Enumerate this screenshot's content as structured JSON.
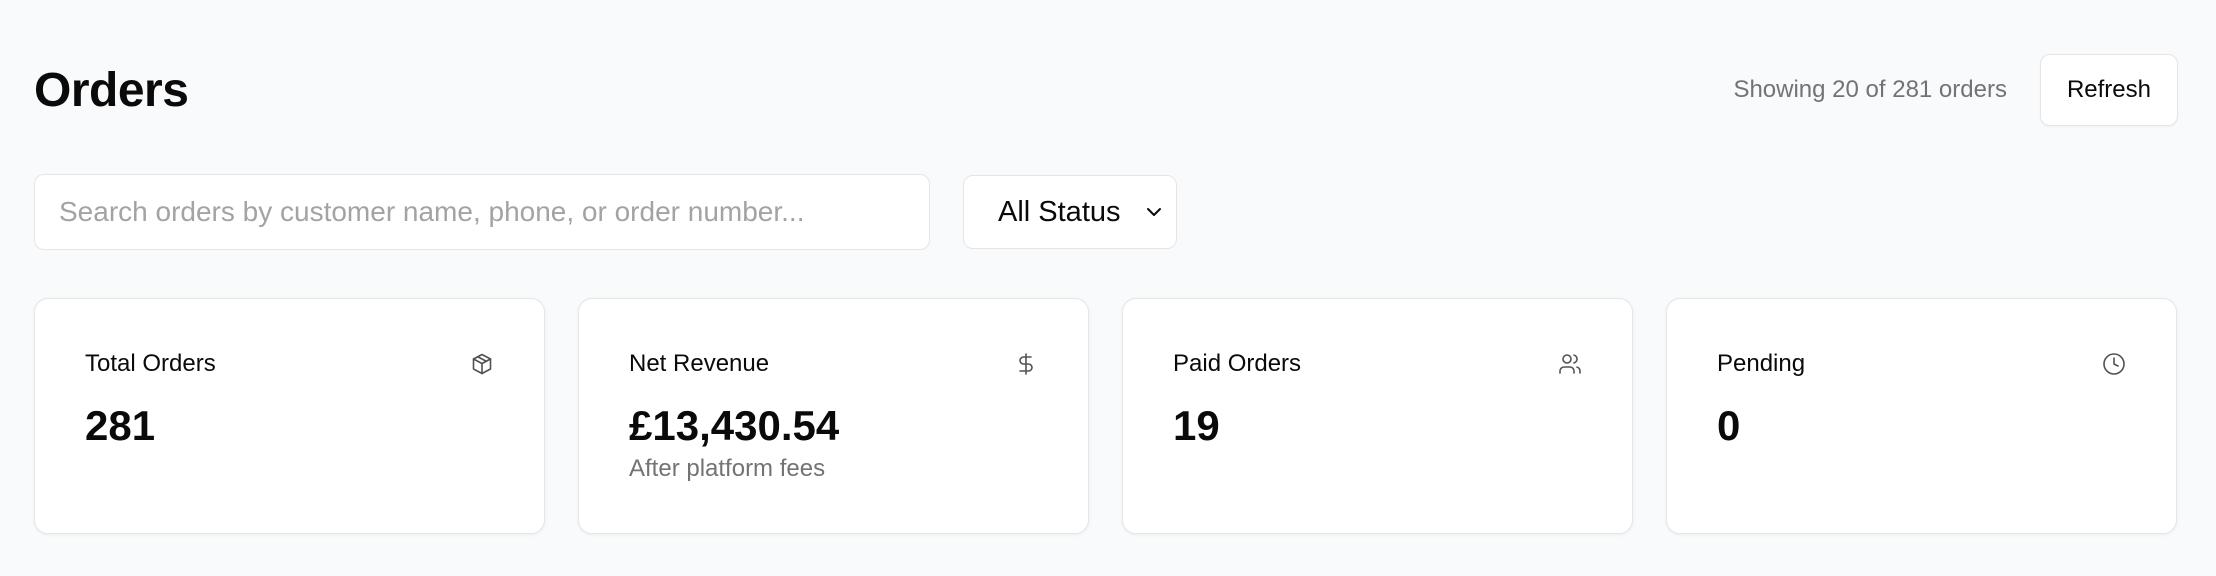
{
  "header": {
    "title": "Orders",
    "showing_text": "Showing 20 of 281 orders",
    "refresh_label": "Refresh"
  },
  "filters": {
    "search_placeholder": "Search orders by customer name, phone, or order number...",
    "search_value": "",
    "status_selected": "All Status"
  },
  "cards": [
    {
      "title": "Total Orders",
      "value": "281",
      "sub": "",
      "icon": "package-icon"
    },
    {
      "title": "Net Revenue",
      "value": "£13,430.54",
      "sub": "After platform fees",
      "icon": "dollar-icon"
    },
    {
      "title": "Paid Orders",
      "value": "19",
      "sub": "",
      "icon": "users-icon"
    },
    {
      "title": "Pending",
      "value": "0",
      "sub": "",
      "icon": "clock-icon"
    }
  ],
  "colors": {
    "background": "#f9fafb",
    "card": "#ffffff",
    "border": "#e5e5e5",
    "muted_text": "#737373",
    "primary_text": "#0a0a0a"
  }
}
